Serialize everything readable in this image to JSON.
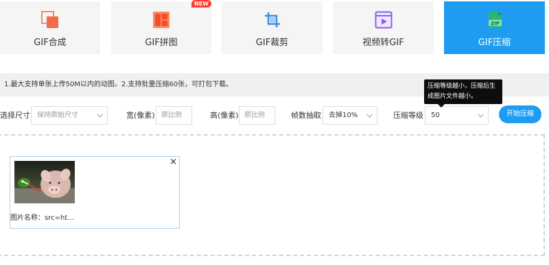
{
  "tabs": [
    {
      "label": "GIF合成",
      "icon": "gif-merge-icon",
      "active": false
    },
    {
      "label": "GIF拼图",
      "icon": "gif-collage-icon",
      "active": false,
      "badge": "NEW"
    },
    {
      "label": "GIF裁剪",
      "icon": "crop-icon",
      "active": false
    },
    {
      "label": "视频转GIF",
      "icon": "video-icon",
      "active": false
    },
    {
      "label": "GIF压缩",
      "icon": "zip-icon",
      "active": true
    }
  ],
  "notice": "1.最大支持单张上传50M以内的动图。2.支持批量压缩60张，可打包下载。",
  "tooltip": {
    "text": "压缩等级越小，压缩后生成图片文件越小。"
  },
  "controls": {
    "size_label": "选择尺寸",
    "size_value": "保持原始尺寸",
    "width_label": "宽(像素)",
    "width_placeholder": "原比例",
    "height_label": "高(像素)",
    "height_placeholder": "原比例",
    "frame_label": "帧数抽取",
    "frame_value": "去掉10%",
    "level_label": "压缩等级",
    "level_value": "50",
    "start_button": "开始压缩"
  },
  "file_card": {
    "name_label": "图片名称：src=ht...",
    "close_symbol": "×"
  },
  "colors": {
    "accent": "#1e9cf2",
    "tab_bg": "#f5f5f5",
    "badge": "#ff3b30",
    "card_border": "#a9d4ef"
  }
}
